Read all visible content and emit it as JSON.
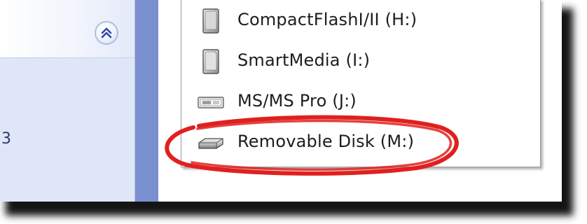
{
  "drive_list": {
    "items": [
      {
        "label": "CompactFlashI/II (H:)",
        "icon": "card-drive-icon"
      },
      {
        "label": "SmartMedia (I:)",
        "icon": "card-drive-icon"
      },
      {
        "label": "MS/MS Pro (J:)",
        "icon": "memory-stick-drive-icon"
      },
      {
        "label": "Removable Disk (M:)",
        "icon": "removable-disk-icon"
      }
    ]
  },
  "task_pane": {
    "collapse_icon": "chevron-double-up-icon",
    "fragment_text": "3"
  },
  "highlight": {
    "target": "Removable Disk (M:)",
    "color": "#e0201f"
  },
  "colors": {
    "taskpane_blue": "#7a8fcf",
    "taskpane_light": "#dfe6f7",
    "chevron": "#2a4aa8"
  }
}
